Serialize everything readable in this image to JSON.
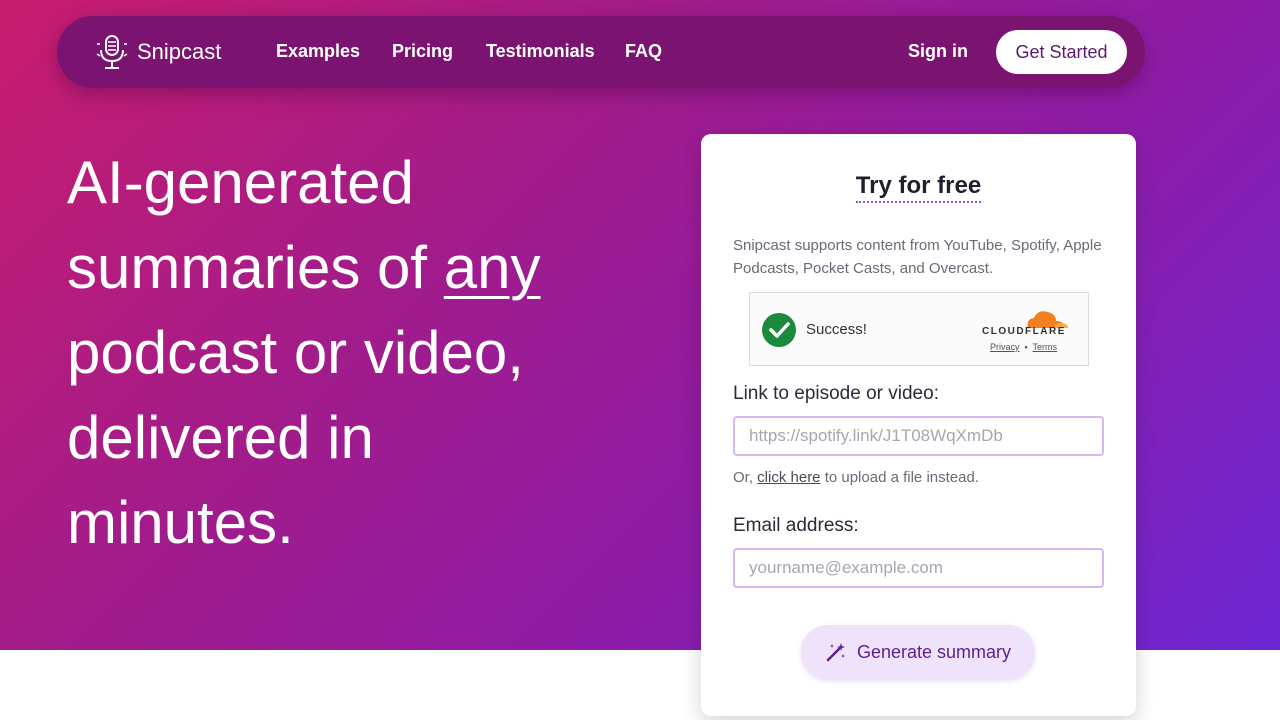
{
  "nav": {
    "brand": "Snipcast",
    "links": [
      "Examples",
      "Pricing",
      "Testimonials",
      "FAQ"
    ],
    "sign_in": "Sign in",
    "get_started": "Get Started"
  },
  "hero": {
    "line1": "AI-generated",
    "line2_prefix": "summaries of ",
    "line2_emph": "any",
    "line3": "podcast or video,",
    "line4": "delivered in",
    "line5": "minutes."
  },
  "card": {
    "title": "Try for free",
    "supports": "Snipcast supports content from YouTube, Spotify, Apple Podcasts, Pocket Casts, and Overcast.",
    "captcha": {
      "status": "Success!",
      "provider": "CLOUDFLARE",
      "privacy": "Privacy",
      "separator": "•",
      "terms": "Terms"
    },
    "link_label": "Link to episode or video:",
    "link_placeholder": "https://spotify.link/J1T08WqXmDb",
    "upload_prefix": "Or, ",
    "upload_link": "click here",
    "upload_suffix": " to upload a file instead.",
    "email_label": "Email address:",
    "email_placeholder": "yourname@example.com",
    "submit": "Generate summary"
  },
  "colors": {
    "gradient_start": "#c81c6e",
    "gradient_end": "#6d27d4",
    "nav_bg": "#7a1470",
    "accent": "#5d1f94",
    "success": "#1a8a3c",
    "cloudflare": "#f38020"
  },
  "icons": [
    "microphone-logo-icon",
    "check-icon",
    "cloudflare-logo-icon",
    "magic-wand-icon"
  ]
}
